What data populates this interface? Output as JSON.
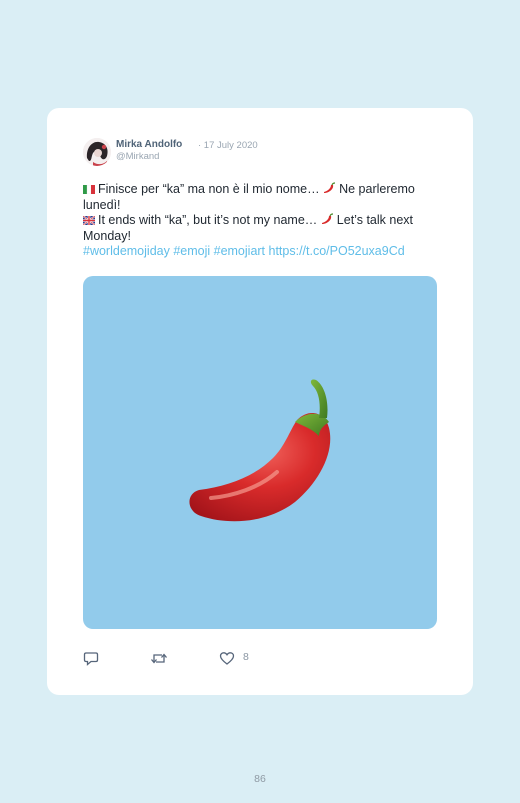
{
  "tweet": {
    "author_name": "Mirka Andolfo",
    "date": "· 17 July 2020",
    "handle": "@Mirkand",
    "line_it_a": "Finisce per “ka” ma non è il mio nome…",
    "line_it_b": "Ne parleremo lunedì!",
    "line_en_a": "It ends with “ka”, but it’s not my name…",
    "line_en_b": "Let’s talk next Monday!",
    "hashtags": "#worldemojiday #emoji #emojiart https://t.co/PO52uxa9Cd",
    "image_description_icon": "hot-pepper-emoji",
    "like_count": "8"
  },
  "icons": {
    "reply": "reply-icon",
    "retweet": "retweet-icon",
    "like": "heart-icon",
    "flag_it": "italy-flag-icon",
    "flag_uk": "uk-flag-icon"
  },
  "page": {
    "number": "86"
  },
  "colors": {
    "background": "#daeef5",
    "card": "#ffffff",
    "image_bg": "#92cbeb",
    "link": "#5fbde8",
    "pepper": "#d92b2b"
  }
}
